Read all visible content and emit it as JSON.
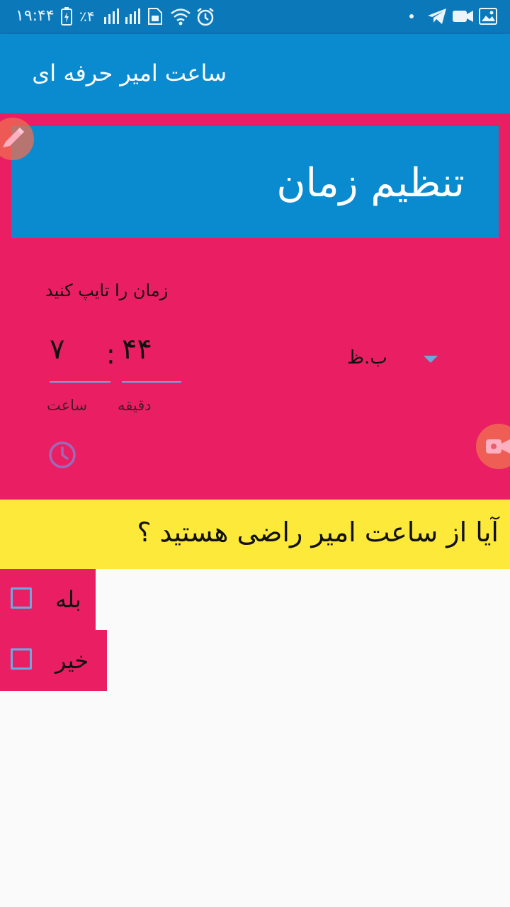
{
  "status_bar": {
    "time": "۱۹:۴۴",
    "battery": "٪۴",
    "icons": [
      "battery-icon",
      "signal-icon",
      "signal-icon",
      "sim-icon",
      "wifi-icon",
      "alarm-icon",
      "dot-icon",
      "telegram-icon",
      "video-icon",
      "image-icon"
    ]
  },
  "app_bar": {
    "title": "ساعت امیر حرفه ای"
  },
  "header_card": {
    "title": "تنظیم زمان"
  },
  "time_picker": {
    "prompt": "زمان را تایپ کنید",
    "hour_value": "۷",
    "minute_value": "۴۴",
    "separator": ":",
    "hour_caption": "ساعت",
    "minute_caption": "دقیقه",
    "ampm_value": "ب.ظ"
  },
  "question": {
    "text": "آیا از ساعت امیر راضی هستید ؟"
  },
  "options": [
    {
      "label": "بله"
    },
    {
      "label": "خیر"
    }
  ],
  "colors": {
    "app_bar": "#0a8bd0",
    "status_bar": "#0b78ba",
    "accent_pink": "#ea1f63",
    "question_yellow": "#fde93a",
    "underline_blue": "#6aa8e0"
  }
}
